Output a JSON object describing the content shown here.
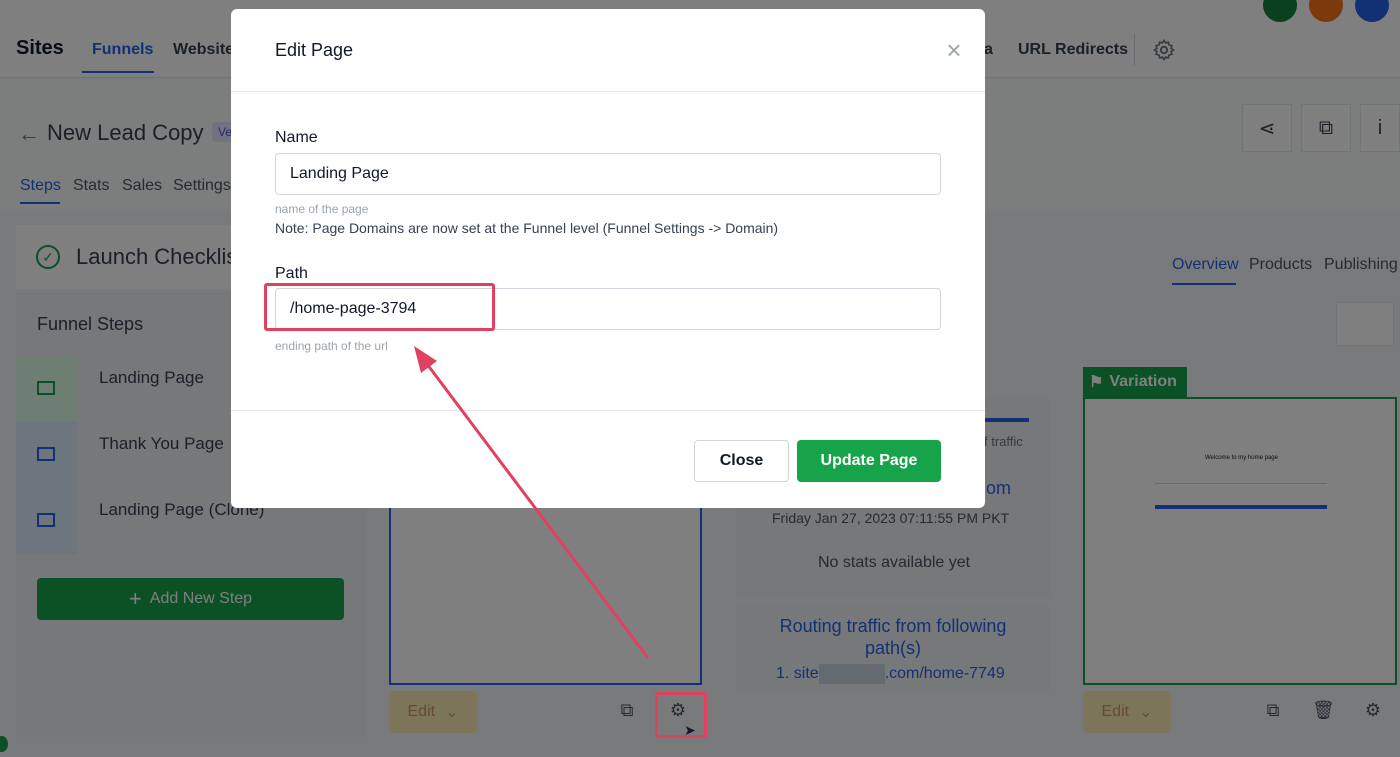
{
  "app": {
    "brand": "Sites",
    "nav_tabs": [
      "Funnels",
      "Websites",
      "a",
      "URL Redirects"
    ]
  },
  "funnel": {
    "title": "New Lead Copy",
    "version_badge": "Ve",
    "subtabs": [
      "Steps",
      "Stats",
      "Sales",
      "Settings"
    ]
  },
  "checklist": {
    "label": "Launch Checklis"
  },
  "steps": {
    "heading": "Funnel Steps",
    "items": [
      "Landing Page",
      "Thank You Page",
      "Landing Page (Clone)"
    ],
    "add_label": "Add New Step"
  },
  "right_tabs": [
    "Overview",
    "Products",
    "Publishing"
  ],
  "stats": {
    "traffic_label": "f traffic",
    "domain": "om",
    "date": "Friday Jan 27, 2023 07:11:55 PM PKT",
    "no_stats": "No stats available yet",
    "routing_title": "Routing traffic from following path(s)",
    "routing_path_prefix": "1. site",
    "routing_path_suffix": ".com/home-7749"
  },
  "variation": {
    "label": "Variation",
    "preview_title": "Welcome to my home page"
  },
  "cards": {
    "edit_label": "Edit"
  },
  "modal": {
    "title": "Edit Page",
    "name_label": "Name",
    "name_value": "Landing Page",
    "name_help": "name of the page",
    "note": "Note: Page Domains are now set at the Funnel level (Funnel Settings -> Domain)",
    "path_label": "Path",
    "path_value": "/home-page-3794",
    "path_help": "ending path of the url",
    "close_label": "Close",
    "update_label": "Update Page"
  },
  "colors": {
    "accent_blue": "#2563eb",
    "accent_green": "#16a34a",
    "annotation_red": "#e0415f"
  },
  "icons": [
    "back-arrow-icon",
    "settings-gear-icon",
    "share-icon",
    "external-link-icon",
    "info-icon",
    "check-circle-icon",
    "mail-icon",
    "plus-icon",
    "flag-icon",
    "chevron-down-icon",
    "trash-icon",
    "close-icon",
    "cursor-icon"
  ]
}
